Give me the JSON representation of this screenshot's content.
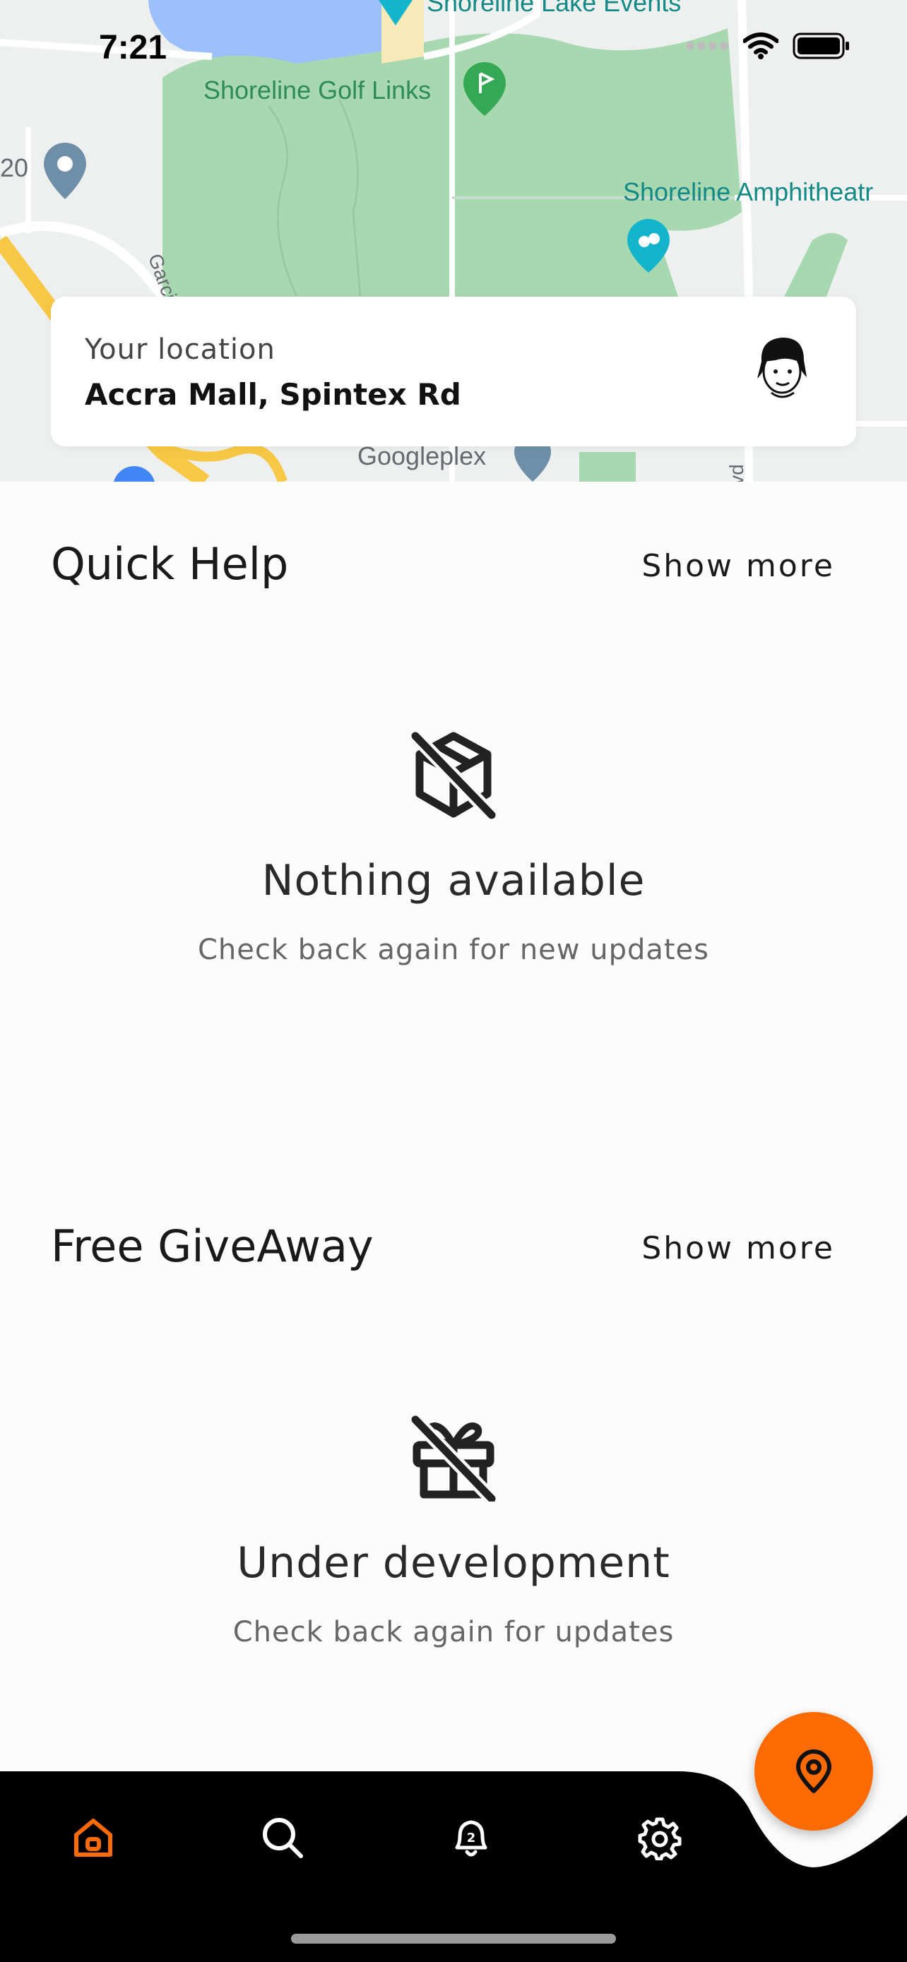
{
  "status_bar": {
    "time": "7:21"
  },
  "map": {
    "labels": [
      "Shoreline Lake Events",
      "Shoreline Golf Links",
      "Shoreline Amphitheatr",
      "20",
      "Garci",
      "Googleplex",
      "vd"
    ]
  },
  "location": {
    "label": "Your location",
    "value": "Accra Mall, Spintex Rd"
  },
  "quick_help": {
    "title": "Quick Help",
    "show_more": "Show more",
    "empty_title": "Nothing available",
    "empty_subtitle": "Check back again for new updates",
    "icon": "package-off-icon"
  },
  "giveaway": {
    "title": "Free GiveAway",
    "show_more": "Show more",
    "empty_title": "Under development",
    "empty_subtitle": "Check back again for updates",
    "icon": "gift-off-icon"
  },
  "nav": {
    "items": [
      "home-icon",
      "search-icon",
      "notification-icon",
      "settings-icon"
    ],
    "active": "home-icon",
    "fab": "location-pin-icon"
  },
  "colors": {
    "accent": "#fc6a04",
    "nav_bg": "#000000",
    "map_green": "#a8d8b0",
    "map_water": "#9cc0f9"
  }
}
